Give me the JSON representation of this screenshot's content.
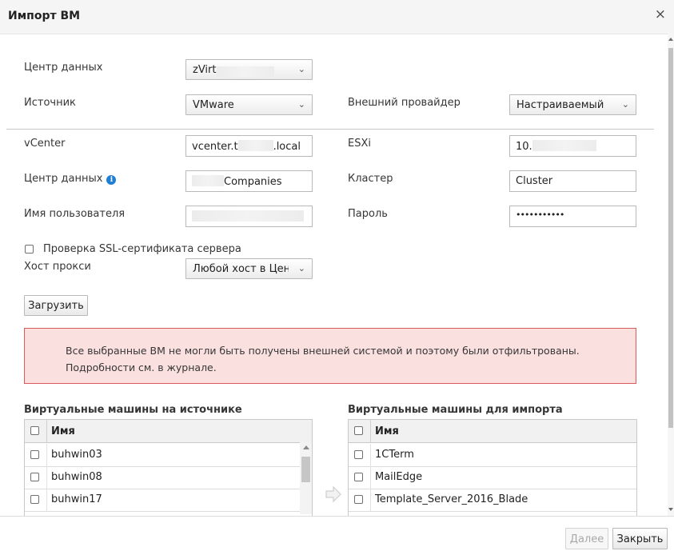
{
  "dialog": {
    "title": "Импорт ВМ",
    "close_label": "×"
  },
  "form": {
    "datacenter_label": "Центр данных",
    "datacenter_value": "zVirt",
    "source_label": "Источник",
    "source_value": "VMware",
    "ext_provider_label": "Внешний провайдер",
    "ext_provider_value": "Настраиваемый",
    "vcenter_label": "vCenter",
    "vcenter_prefix": "vcenter.t",
    "vcenter_suffix": ".local",
    "esxi_label": "ESXi",
    "esxi_value": "10.",
    "dc2_label": "Центр данных",
    "dc2_value": "Companies",
    "cluster_label": "Кластер",
    "cluster_value": "Cluster",
    "username_label": "Имя пользователя",
    "password_label": "Пароль",
    "password_value": "•••••••••••",
    "ssl_label": "Проверка SSL-сертификата сервера",
    "proxy_host_label": "Хост прокси",
    "proxy_host_value": "Любой хост в Цент",
    "load_button": "Загрузить"
  },
  "alert": {
    "line1": "Все выбранные ВМ не могли быть получены внешней системой и поэтому были отфильтрованы.",
    "line2": "Подробности см. в журнале."
  },
  "source_vms": {
    "title": "Виртуальные машины на источнике",
    "column_name": "Имя",
    "rows": [
      "buhwin03",
      "buhwin08",
      "buhwin17"
    ]
  },
  "import_vms": {
    "title": "Виртуальные машины для импорта",
    "column_name": "Имя",
    "rows": [
      "1CTerm",
      "MailEdge",
      "Template_Server_2016_Blade"
    ]
  },
  "footer": {
    "next_button": "Далее",
    "close_button": "Закрыть"
  },
  "icons": {
    "close": "close-icon",
    "chevron": "chevron-down-icon",
    "info": "info-icon",
    "move": "arrow-right-icon"
  }
}
